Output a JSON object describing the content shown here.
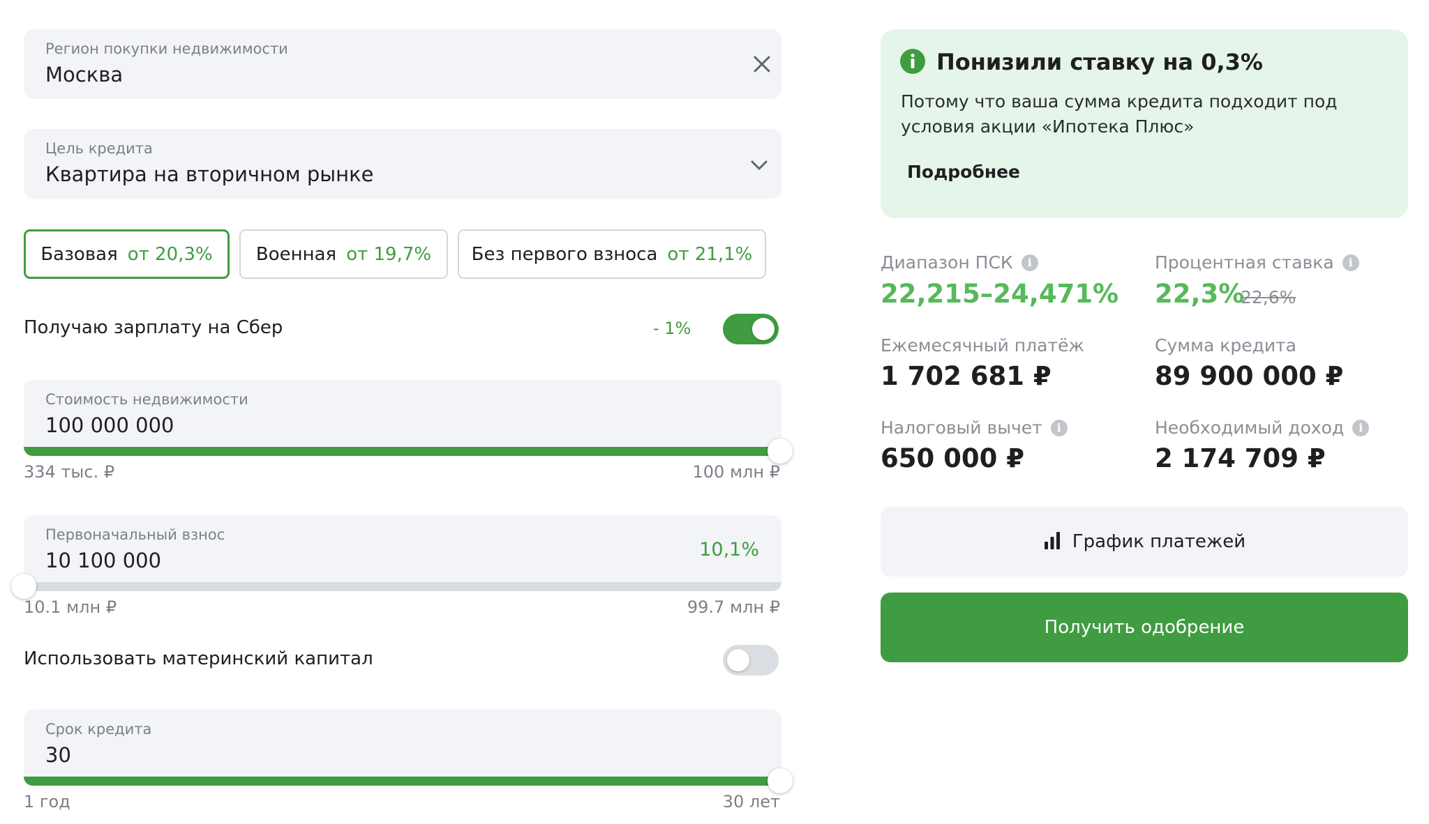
{
  "region": {
    "label": "Регион покупки недвижимости",
    "value": "Москва"
  },
  "purpose": {
    "label": "Цель кредита",
    "value": "Квартира на вторичном рынке"
  },
  "programs": [
    {
      "name": "Базовая",
      "rate": "от 20,3%",
      "active": true
    },
    {
      "name": "Военная",
      "rate": "от 19,7%",
      "active": false
    },
    {
      "name": "Без первого взноса",
      "rate": "от 21,1%",
      "active": false
    }
  ],
  "salary": {
    "label": "Получаю зарплату на Сбер",
    "discount": "- 1%",
    "enabled": true
  },
  "property_cost": {
    "label": "Стоимость недвижимости",
    "value": "100 000 000",
    "min": "334 тыс. ₽",
    "max": "100 млн ₽",
    "fill": 1.0
  },
  "down_payment": {
    "label": "Первоначальный взнос",
    "value": "10 100 000",
    "percent": "10,1%",
    "min": "10.1 млн ₽",
    "max": "99.7 млн ₽",
    "fill": 0.0
  },
  "maternity": {
    "label": "Использовать материнский капитал",
    "enabled": false
  },
  "term": {
    "label": "Срок кредита",
    "value": "30",
    "min": "1 год",
    "max": "30 лет",
    "fill": 1.0
  },
  "promo": {
    "title": "Понизили ставку на 0,3%",
    "text": "Потому что ваша сумма кредита подходит под условия акции «Ипотека Плюс»",
    "link": "Подробнее"
  },
  "stats": {
    "psk": {
      "label": "Диапазон ПСК",
      "value": "22,215–24,471%"
    },
    "rate": {
      "label": "Процентная ставка",
      "value": "22,3%",
      "old": "22,6%"
    },
    "monthly": {
      "label": "Ежемесячный платёж",
      "value": "1 702 681 ₽"
    },
    "loan": {
      "label": "Сумма кредита",
      "value": "89 900 000 ₽"
    },
    "tax": {
      "label": "Налоговый вычет",
      "value": "650 000 ₽"
    },
    "income": {
      "label": "Необходимый доход",
      "value": "2 174 709 ₽"
    }
  },
  "buttons": {
    "schedule": "График платежей",
    "approval": "Получить одобрение"
  },
  "colors": {
    "accent": "#3f9c41",
    "promo_bg": "#e6f5e9",
    "field_bg": "#f2f4f7"
  }
}
